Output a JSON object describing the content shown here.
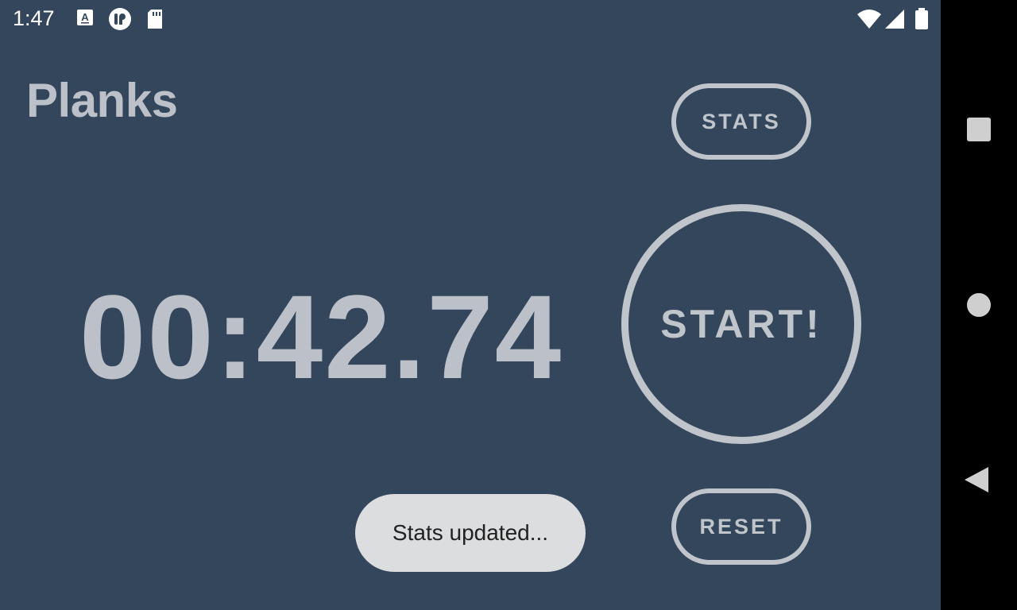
{
  "status_bar": {
    "time": "1:47",
    "icons": [
      "font-a-icon",
      "app-notification-icon",
      "sd-card-icon",
      "wifi-icon",
      "cellular-signal-icon",
      "battery-icon"
    ]
  },
  "app": {
    "title": "Planks",
    "stats_label": "STATS",
    "timer": "00:42.74",
    "start_label": "START!",
    "reset_label": "RESET"
  },
  "toast": {
    "message": "Stats updated..."
  },
  "nav_bar": {
    "icons": [
      "recents-icon",
      "home-icon",
      "back-icon"
    ]
  },
  "colors": {
    "background": "#34465b",
    "foreground": "#c0c4cb",
    "toast_bg": "#dcdddf"
  }
}
